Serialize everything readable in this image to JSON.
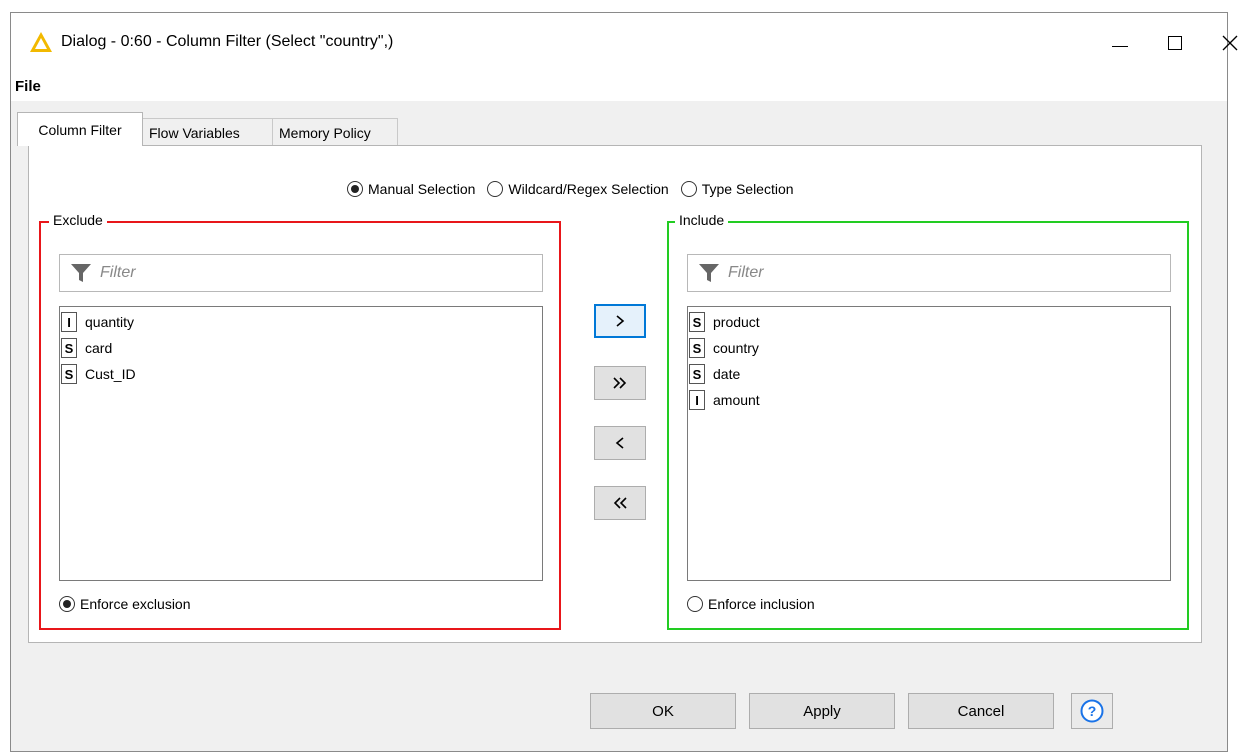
{
  "window": {
    "title": "Dialog - 0:60 - Column Filter (Select \"country\",)",
    "icon": "warning-triangle-icon"
  },
  "menu": {
    "file": "File"
  },
  "tabs": [
    {
      "label": "Column Filter",
      "active": true
    },
    {
      "label": "Flow Variables",
      "active": false
    },
    {
      "label": "Memory Policy",
      "active": false
    }
  ],
  "selection_modes": {
    "options": [
      "Manual Selection",
      "Wildcard/Regex Selection",
      "Type Selection"
    ],
    "selected": "Manual Selection"
  },
  "exclude": {
    "title": "Exclude",
    "border_color": "#e8161a",
    "filter_placeholder": "Filter",
    "items": [
      {
        "type": "I",
        "name": "quantity"
      },
      {
        "type": "S",
        "name": "card"
      },
      {
        "type": "S",
        "name": "Cust_ID"
      }
    ],
    "enforce_label": "Enforce exclusion",
    "enforce_selected": true
  },
  "include": {
    "title": "Include",
    "border_color": "#22cc22",
    "filter_placeholder": "Filter",
    "items": [
      {
        "type": "S",
        "name": "product"
      },
      {
        "type": "S",
        "name": "country"
      },
      {
        "type": "S",
        "name": "date"
      },
      {
        "type": "I",
        "name": "amount"
      }
    ],
    "enforce_label": "Enforce inclusion",
    "enforce_selected": false
  },
  "move_buttons": {
    "right": ">",
    "all_right": ">>",
    "left": "<",
    "all_left": "<<"
  },
  "buttons": {
    "ok": "OK",
    "apply": "Apply",
    "cancel": "Cancel",
    "help": "?"
  },
  "colors": {
    "accent": "#0078d7",
    "warning": "#f2b900"
  }
}
